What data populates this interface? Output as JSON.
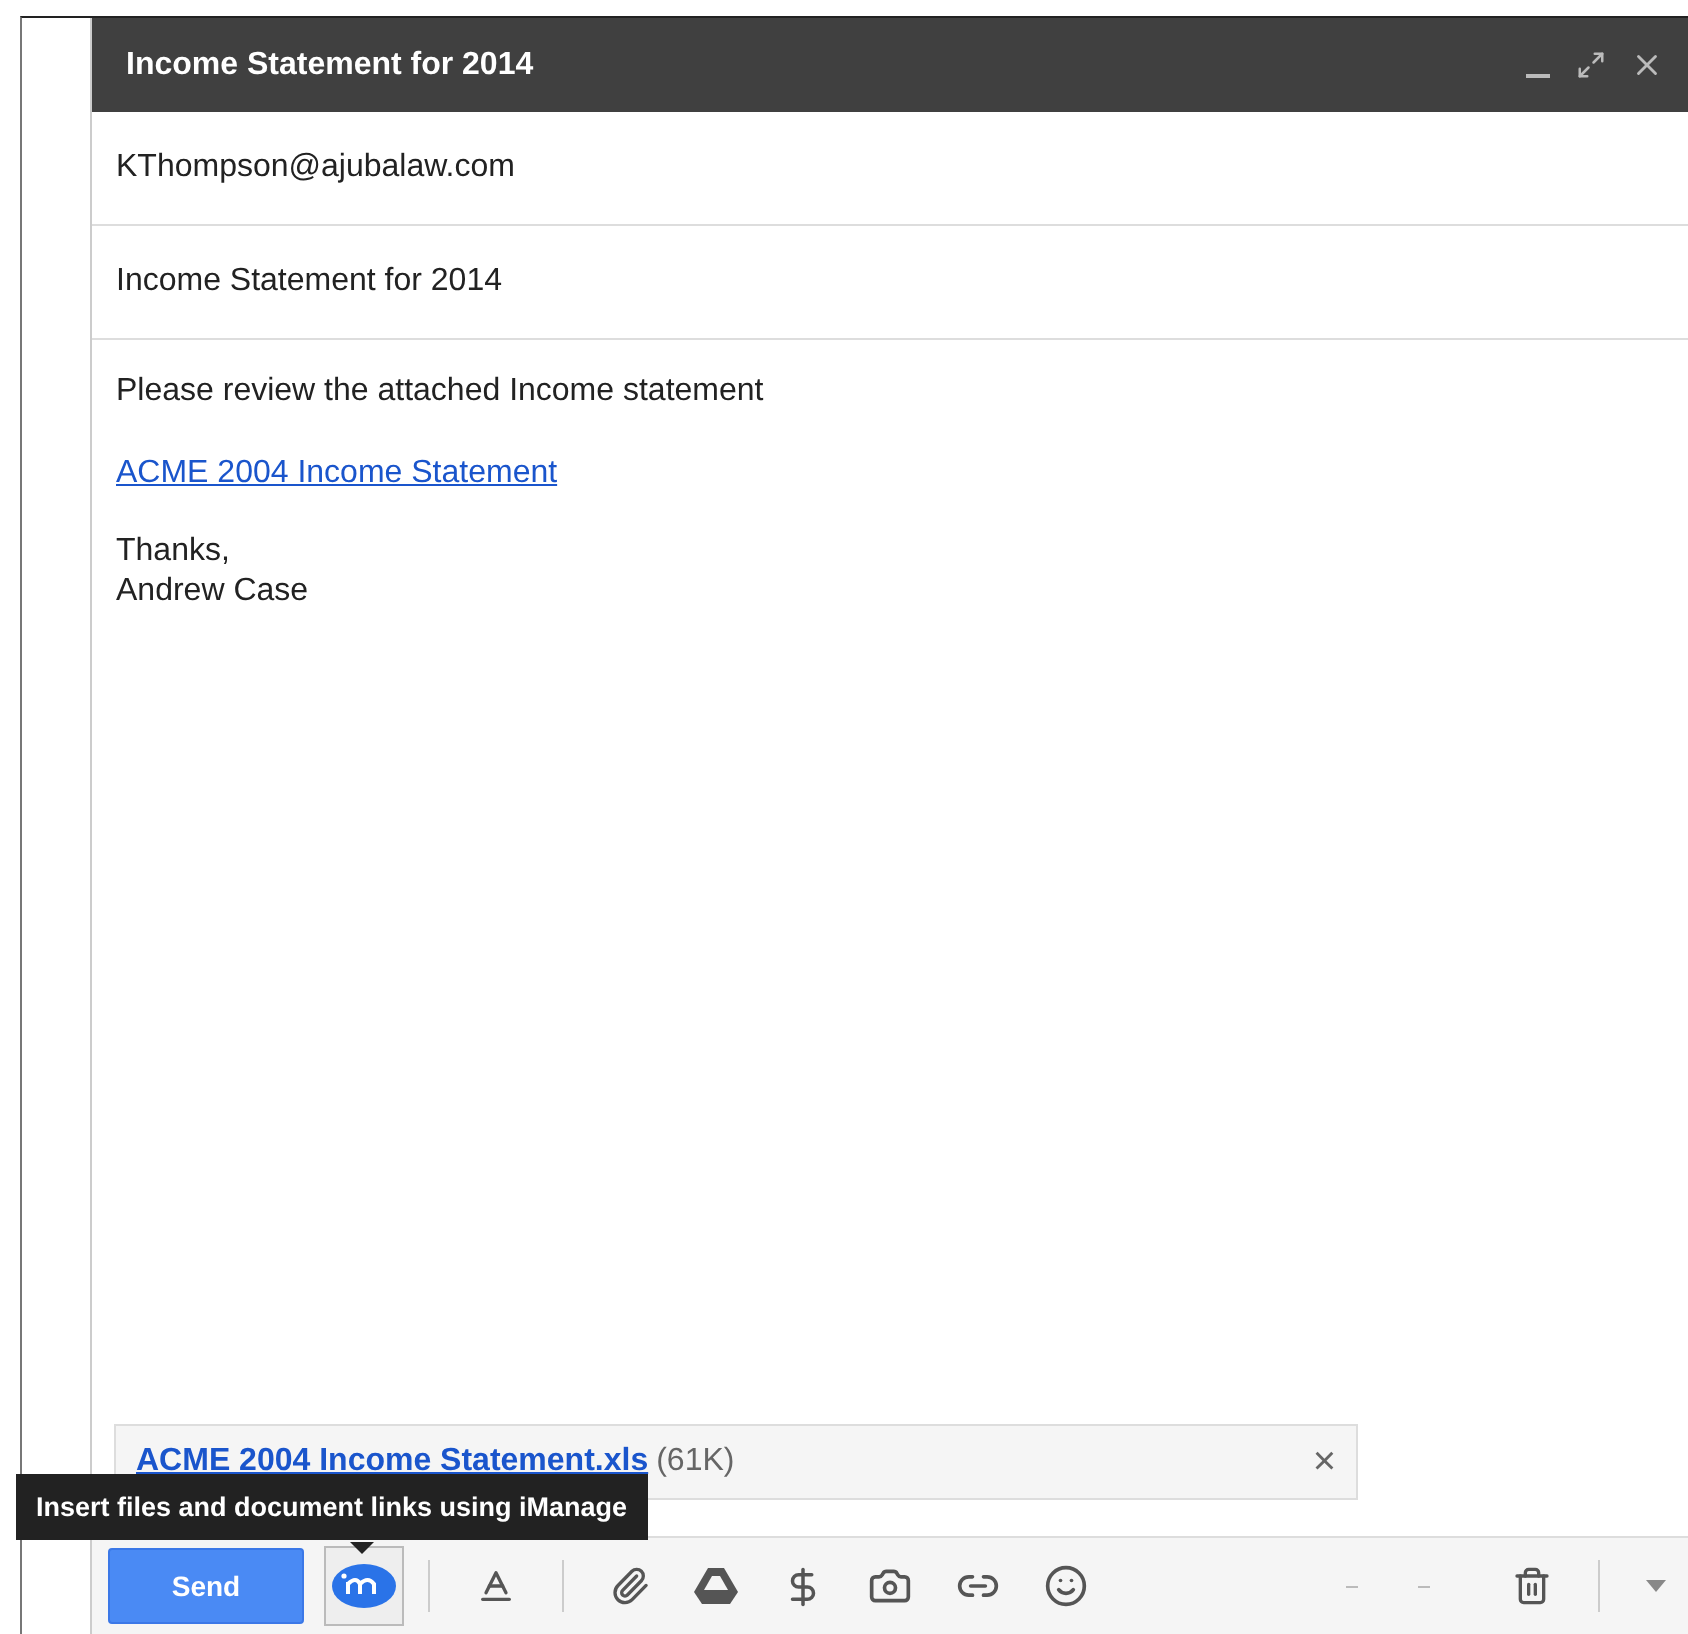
{
  "window": {
    "title": "Income Statement for 2014"
  },
  "to": {
    "value": "KThompson@ajubalaw.com"
  },
  "subject": {
    "value": "Income Statement for 2014"
  },
  "body": {
    "intro": "Please review the attached Income statement",
    "link": "ACME 2004 Income Statement",
    "closing": "Thanks,",
    "signature": "Andrew Case"
  },
  "attachment": {
    "name": "ACME 2004 Income Statement.xls",
    "size": "(61K)",
    "remove": "×"
  },
  "tooltip": {
    "text": "Insert files and document links using iManage"
  },
  "toolbar": {
    "send": "Send"
  }
}
